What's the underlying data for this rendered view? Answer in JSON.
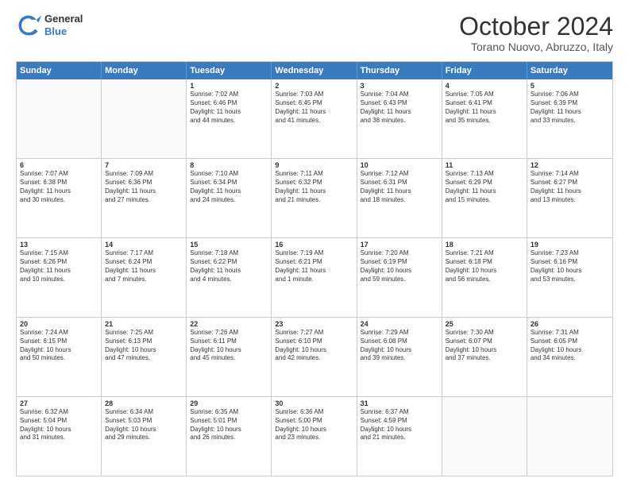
{
  "header": {
    "logo_line1": "General",
    "logo_line2": "Blue",
    "month_title": "October 2024",
    "location": "Torano Nuovo, Abruzzo, Italy"
  },
  "days_of_week": [
    "Sunday",
    "Monday",
    "Tuesday",
    "Wednesday",
    "Thursday",
    "Friday",
    "Saturday"
  ],
  "weeks": [
    [
      {
        "day": "",
        "empty": true
      },
      {
        "day": "",
        "empty": true
      },
      {
        "day": "1",
        "line1": "Sunrise: 7:02 AM",
        "line2": "Sunset: 6:46 PM",
        "line3": "Daylight: 11 hours",
        "line4": "and 44 minutes."
      },
      {
        "day": "2",
        "line1": "Sunrise: 7:03 AM",
        "line2": "Sunset: 6:45 PM",
        "line3": "Daylight: 11 hours",
        "line4": "and 41 minutes."
      },
      {
        "day": "3",
        "line1": "Sunrise: 7:04 AM",
        "line2": "Sunset: 6:43 PM",
        "line3": "Daylight: 11 hours",
        "line4": "and 38 minutes."
      },
      {
        "day": "4",
        "line1": "Sunrise: 7:05 AM",
        "line2": "Sunset: 6:41 PM",
        "line3": "Daylight: 11 hours",
        "line4": "and 35 minutes."
      },
      {
        "day": "5",
        "line1": "Sunrise: 7:06 AM",
        "line2": "Sunset: 6:39 PM",
        "line3": "Daylight: 11 hours",
        "line4": "and 33 minutes."
      }
    ],
    [
      {
        "day": "6",
        "line1": "Sunrise: 7:07 AM",
        "line2": "Sunset: 6:38 PM",
        "line3": "Daylight: 11 hours",
        "line4": "and 30 minutes."
      },
      {
        "day": "7",
        "line1": "Sunrise: 7:09 AM",
        "line2": "Sunset: 6:36 PM",
        "line3": "Daylight: 11 hours",
        "line4": "and 27 minutes."
      },
      {
        "day": "8",
        "line1": "Sunrise: 7:10 AM",
        "line2": "Sunset: 6:34 PM",
        "line3": "Daylight: 11 hours",
        "line4": "and 24 minutes."
      },
      {
        "day": "9",
        "line1": "Sunrise: 7:11 AM",
        "line2": "Sunset: 6:32 PM",
        "line3": "Daylight: 11 hours",
        "line4": "and 21 minutes."
      },
      {
        "day": "10",
        "line1": "Sunrise: 7:12 AM",
        "line2": "Sunset: 6:31 PM",
        "line3": "Daylight: 11 hours",
        "line4": "and 18 minutes."
      },
      {
        "day": "11",
        "line1": "Sunrise: 7:13 AM",
        "line2": "Sunset: 6:29 PM",
        "line3": "Daylight: 11 hours",
        "line4": "and 15 minutes."
      },
      {
        "day": "12",
        "line1": "Sunrise: 7:14 AM",
        "line2": "Sunset: 6:27 PM",
        "line3": "Daylight: 11 hours",
        "line4": "and 13 minutes."
      }
    ],
    [
      {
        "day": "13",
        "line1": "Sunrise: 7:15 AM",
        "line2": "Sunset: 6:26 PM",
        "line3": "Daylight: 11 hours",
        "line4": "and 10 minutes."
      },
      {
        "day": "14",
        "line1": "Sunrise: 7:17 AM",
        "line2": "Sunset: 6:24 PM",
        "line3": "Daylight: 11 hours",
        "line4": "and 7 minutes."
      },
      {
        "day": "15",
        "line1": "Sunrise: 7:18 AM",
        "line2": "Sunset: 6:22 PM",
        "line3": "Daylight: 11 hours",
        "line4": "and 4 minutes."
      },
      {
        "day": "16",
        "line1": "Sunrise: 7:19 AM",
        "line2": "Sunset: 6:21 PM",
        "line3": "Daylight: 11 hours",
        "line4": "and 1 minute."
      },
      {
        "day": "17",
        "line1": "Sunrise: 7:20 AM",
        "line2": "Sunset: 6:19 PM",
        "line3": "Daylight: 10 hours",
        "line4": "and 59 minutes."
      },
      {
        "day": "18",
        "line1": "Sunrise: 7:21 AM",
        "line2": "Sunset: 6:18 PM",
        "line3": "Daylight: 10 hours",
        "line4": "and 56 minutes."
      },
      {
        "day": "19",
        "line1": "Sunrise: 7:23 AM",
        "line2": "Sunset: 6:16 PM",
        "line3": "Daylight: 10 hours",
        "line4": "and 53 minutes."
      }
    ],
    [
      {
        "day": "20",
        "line1": "Sunrise: 7:24 AM",
        "line2": "Sunset: 6:15 PM",
        "line3": "Daylight: 10 hours",
        "line4": "and 50 minutes."
      },
      {
        "day": "21",
        "line1": "Sunrise: 7:25 AM",
        "line2": "Sunset: 6:13 PM",
        "line3": "Daylight: 10 hours",
        "line4": "and 47 minutes."
      },
      {
        "day": "22",
        "line1": "Sunrise: 7:26 AM",
        "line2": "Sunset: 6:11 PM",
        "line3": "Daylight: 10 hours",
        "line4": "and 45 minutes."
      },
      {
        "day": "23",
        "line1": "Sunrise: 7:27 AM",
        "line2": "Sunset: 6:10 PM",
        "line3": "Daylight: 10 hours",
        "line4": "and 42 minutes."
      },
      {
        "day": "24",
        "line1": "Sunrise: 7:29 AM",
        "line2": "Sunset: 6:08 PM",
        "line3": "Daylight: 10 hours",
        "line4": "and 39 minutes."
      },
      {
        "day": "25",
        "line1": "Sunrise: 7:30 AM",
        "line2": "Sunset: 6:07 PM",
        "line3": "Daylight: 10 hours",
        "line4": "and 37 minutes."
      },
      {
        "day": "26",
        "line1": "Sunrise: 7:31 AM",
        "line2": "Sunset: 6:05 PM",
        "line3": "Daylight: 10 hours",
        "line4": "and 34 minutes."
      }
    ],
    [
      {
        "day": "27",
        "line1": "Sunrise: 6:32 AM",
        "line2": "Sunset: 5:04 PM",
        "line3": "Daylight: 10 hours",
        "line4": "and 31 minutes."
      },
      {
        "day": "28",
        "line1": "Sunrise: 6:34 AM",
        "line2": "Sunset: 5:03 PM",
        "line3": "Daylight: 10 hours",
        "line4": "and 29 minutes."
      },
      {
        "day": "29",
        "line1": "Sunrise: 6:35 AM",
        "line2": "Sunset: 5:01 PM",
        "line3": "Daylight: 10 hours",
        "line4": "and 26 minutes."
      },
      {
        "day": "30",
        "line1": "Sunrise: 6:36 AM",
        "line2": "Sunset: 5:00 PM",
        "line3": "Daylight: 10 hours",
        "line4": "and 23 minutes."
      },
      {
        "day": "31",
        "line1": "Sunrise: 6:37 AM",
        "line2": "Sunset: 4:59 PM",
        "line3": "Daylight: 10 hours",
        "line4": "and 21 minutes."
      },
      {
        "day": "",
        "empty": true
      },
      {
        "day": "",
        "empty": true
      }
    ]
  ]
}
